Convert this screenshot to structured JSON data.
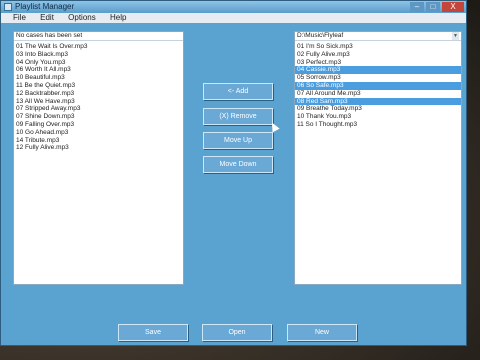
{
  "window": {
    "title": "Playlist Manager",
    "controls": {
      "minimize": "–",
      "maximize": "□",
      "close": "X"
    }
  },
  "menu": [
    "File",
    "Edit",
    "Options",
    "Help"
  ],
  "left_list": {
    "header": "No cases has been set",
    "items": [
      "01 The Wait Is Over.mp3",
      "03 Into Black.mp3",
      "04 Only You.mp3",
      "06 Worth It All.mp3",
      "10 Beautiful.mp3",
      "11 Be the Quiet.mp3",
      "12 Backtrabber.mp3",
      "13 All We Have.mp3",
      "07 Stripped Away.mp3",
      "07 Shine Down.mp3",
      "09 Falling Over.mp3",
      "10 Go Ahead.mp3",
      "14 Tribute.mp3",
      "12 Fully Alive.mp3"
    ]
  },
  "right_list": {
    "path": "D:\\Music\\Flyleaf",
    "items": [
      {
        "text": "01 I'm So Sick.mp3",
        "selected": false
      },
      {
        "text": "02 Fully Alive.mp3",
        "selected": false
      },
      {
        "text": "03 Perfect.mp3",
        "selected": false
      },
      {
        "text": "04 Cassie.mp3",
        "selected": true
      },
      {
        "text": "05 Sorrow.mp3",
        "selected": false
      },
      {
        "text": "06 So Safe.mp3",
        "selected": true
      },
      {
        "text": "07 All Around Me.mp3",
        "selected": false
      },
      {
        "text": "08 Red Sam.mp3",
        "selected": true
      },
      {
        "text": "09 Breathe Today.mp3",
        "selected": false
      },
      {
        "text": "10 Thank You.mp3",
        "selected": false
      },
      {
        "text": "11 So I Thought.mp3",
        "selected": false
      }
    ]
  },
  "buttons": {
    "add": "<- Add",
    "remove": "(X) Remove",
    "move_up": "Move Up",
    "move_down": "Move Down",
    "save": "Save",
    "open": "Open",
    "new": "New"
  },
  "colors": {
    "window_bg": "#5aa2cf",
    "selection": "#4a9ee0"
  }
}
